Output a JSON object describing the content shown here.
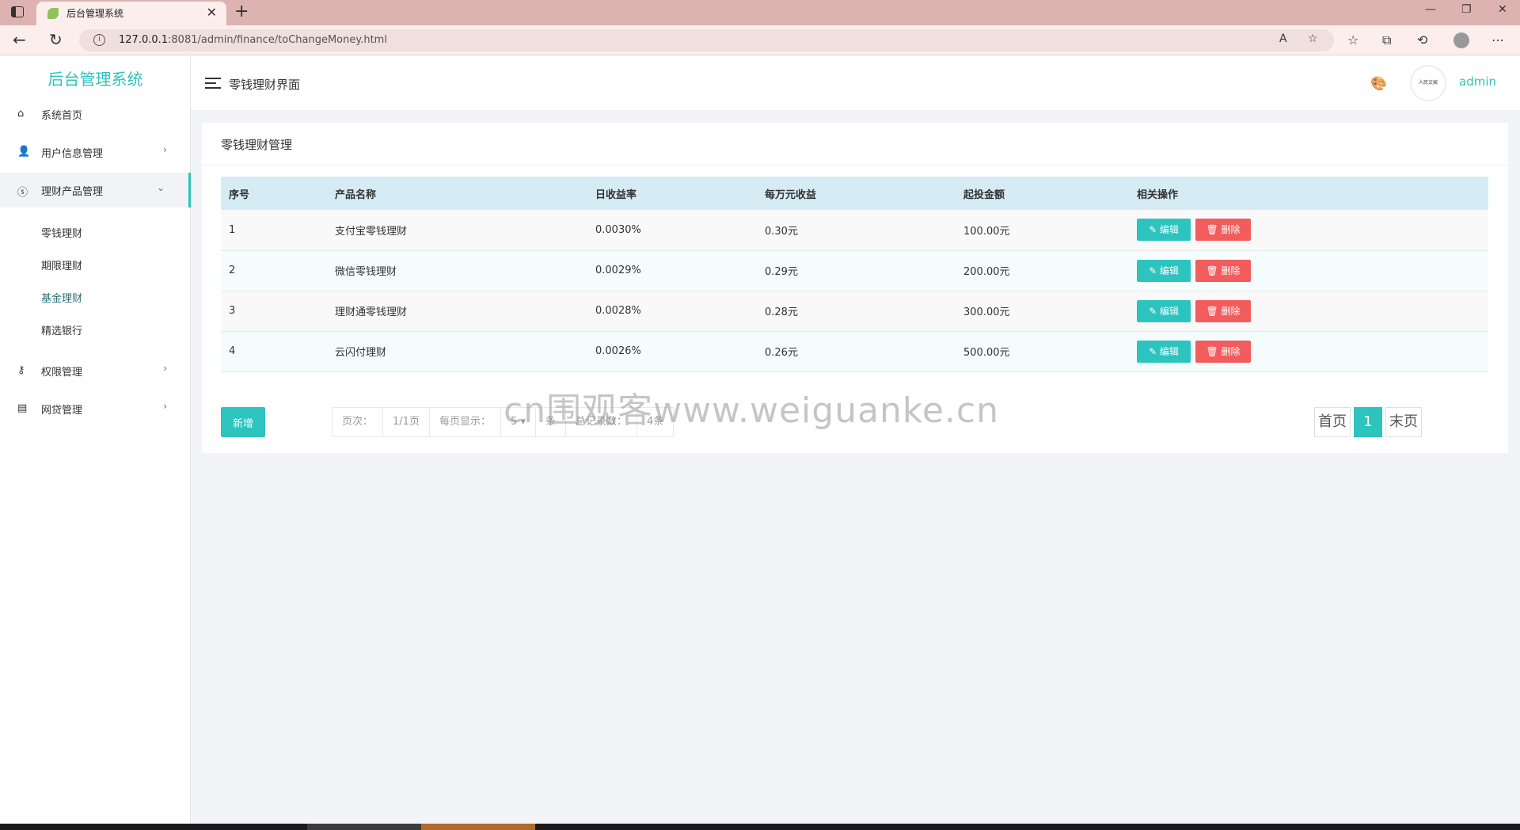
{
  "browser": {
    "tab_title": "后台管理系统",
    "url_host": "127.0.0.1",
    "url_rest": ":8081/admin/finance/toChangeMoney.html"
  },
  "sidebar": {
    "logo": "后台管理系统",
    "items": [
      {
        "label": "系统首页",
        "icon": "home-icon"
      },
      {
        "label": "用户信息管理",
        "icon": "user-gear-icon"
      },
      {
        "label": "理财产品管理",
        "icon": "money-icon"
      },
      {
        "label": "权限管理",
        "icon": "key-icon"
      },
      {
        "label": "网贷管理",
        "icon": "comment-icon"
      }
    ],
    "sub_items": [
      "零钱理财",
      "期限理财",
      "基金理财",
      "精选银行"
    ]
  },
  "header": {
    "title": "零钱理财界面",
    "user": "admin",
    "avatar_text": "人民文娱"
  },
  "card": {
    "title": "零钱理财管理",
    "columns": [
      "序号",
      "产品名称",
      "日收益率",
      "每万元收益",
      "起投金额",
      "相关操作"
    ],
    "rows": [
      {
        "id": "1",
        "name": "支付宝零钱理财",
        "rate": "0.0030%",
        "per10k": "0.30元",
        "min": "100.00元"
      },
      {
        "id": "2",
        "name": "微信零钱理财",
        "rate": "0.0029%",
        "per10k": "0.29元",
        "min": "200.00元"
      },
      {
        "id": "3",
        "name": "理财通零钱理财",
        "rate": "0.0028%",
        "per10k": "0.28元",
        "min": "300.00元"
      },
      {
        "id": "4",
        "name": "云闪付理财",
        "rate": "0.0026%",
        "per10k": "0.26元",
        "min": "500.00元"
      }
    ],
    "edit_label": "✎ 编辑",
    "delete_label": "🗑 删除",
    "add_label": "新增"
  },
  "pager": {
    "page_label": "页次：",
    "page_value": "1/1页",
    "per_page_label": "每页显示：",
    "per_page_value": "5 ▾",
    "unit": "条",
    "total_label": "总记录数：",
    "total_value": "4条",
    "first": "首页",
    "current": "1",
    "last": "末页"
  },
  "watermark": "cn围观客www.weiguanke.cn"
}
